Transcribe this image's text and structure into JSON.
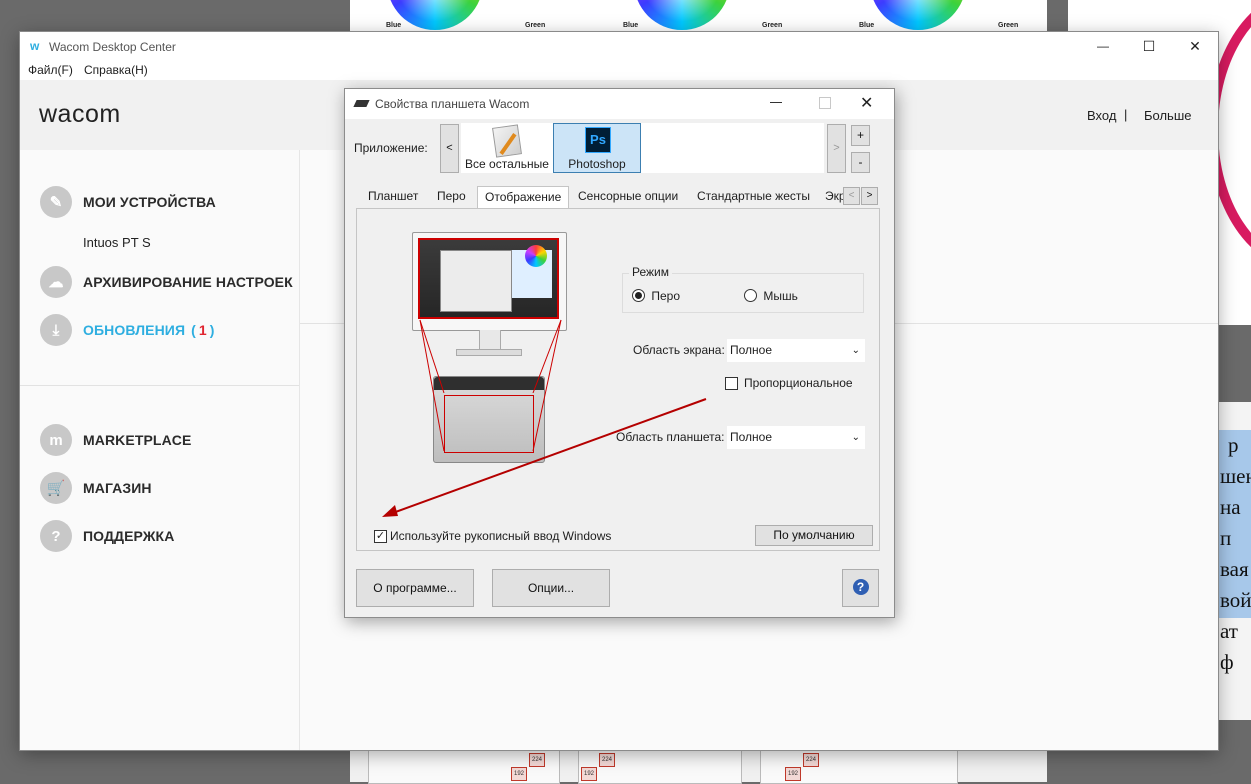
{
  "window": {
    "title": "Wacom Desktop Center",
    "controls": {
      "minimize": "—",
      "maximize": "☐",
      "close": "✕"
    }
  },
  "menu": {
    "file": "Файл(F)",
    "help": "Справка(H)"
  },
  "header": {
    "logo": "wacom",
    "login": "Вход",
    "separator": "|",
    "more": "Больше"
  },
  "sidebar": {
    "my_devices": "МОИ УСТРОЙСТВА",
    "device_name": "Intuos PT S",
    "backup": "АРХИВИРОВАНИЕ НАСТРОЕК",
    "updates": "ОБНОВЛЕНИЯ",
    "updates_paren_open": "(",
    "updates_count": "1",
    "updates_paren_close": ")",
    "marketplace": "MARKETPLACE",
    "shop": "МАГАЗИН",
    "support": "ПОДДЕРЖКА"
  },
  "dialog": {
    "title": "Свойства планшета Wacom",
    "app_label": "Приложение:",
    "scroll_left": "<",
    "scroll_right": ">",
    "apps": [
      {
        "label": "Все остальные"
      },
      {
        "label": "Photoshop",
        "icon_text": "Ps"
      }
    ],
    "add": "+",
    "remove": "-",
    "tabs": [
      "Планшет",
      "Перо",
      "Отображение",
      "Сенсорные опции",
      "Стандартные жесты",
      "Экр"
    ],
    "tab_prev": "<",
    "tab_next": ">",
    "mode_group": "Режим",
    "mode_pen": "Перо",
    "mode_mouse": "Мышь",
    "screen_area_label": "Область экрана:",
    "screen_area_value": "Полное",
    "proportional": "Пропорциональное",
    "tablet_area_label": "Область планшета:",
    "tablet_area_value": "Полное",
    "windows_ink": "Используйте рукописный ввод Windows",
    "default_button": "По умолчанию",
    "about_button": "О программе...",
    "options_button": "Опции...",
    "help_button": "?"
  },
  "background": {
    "wheel_labels": [
      "Blue",
      "Green",
      "Blue",
      "Green",
      "Blue",
      "Green"
    ],
    "grid_labels": [
      "224",
      "192",
      "224",
      "192",
      "224",
      "192"
    ],
    "side_text": [
      "р",
      "шен",
      "на п",
      "вая",
      "вой",
      "ат ф"
    ]
  },
  "colors": {
    "accent": "#2eaee0",
    "update_count": "#e0242f",
    "annotation_arrow": "#b40000",
    "mapping_lines": "#cc0000"
  }
}
